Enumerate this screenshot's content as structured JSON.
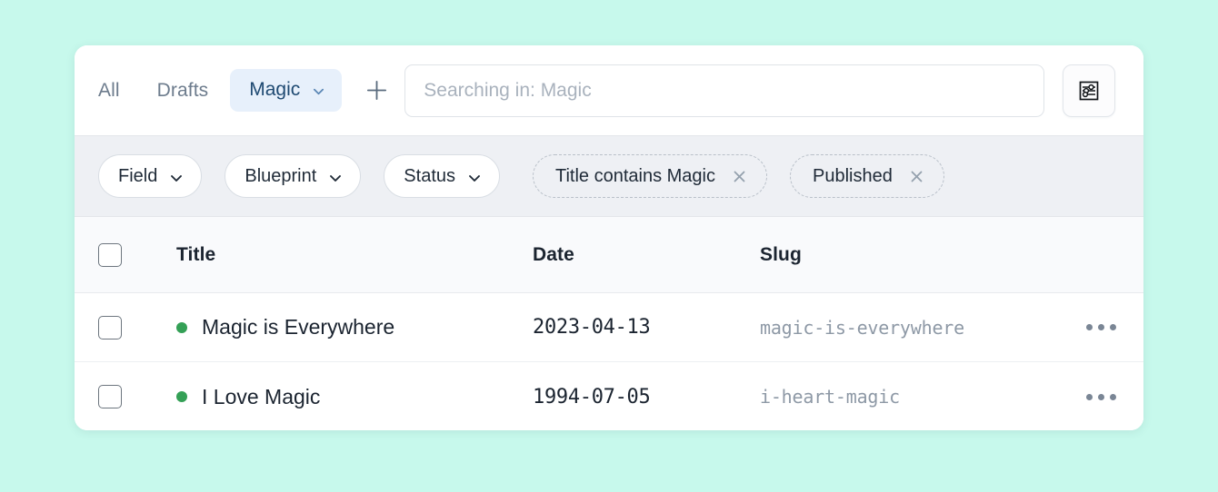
{
  "page": {
    "background_color": "#c7f9ec",
    "card_background": "#ffffff"
  },
  "topbar": {
    "tabs": [
      {
        "label": "All",
        "active": false
      },
      {
        "label": "Drafts",
        "active": false
      },
      {
        "label": "Magic",
        "active": true
      }
    ],
    "active_tab_chevron": "chevron-down-icon",
    "add_button": {
      "label": "+",
      "icon": "plus-icon"
    },
    "search": {
      "value": "",
      "placeholder": "Searching in: Magic",
      "icon": "search-input"
    },
    "filter_toggle": {
      "icon": "sliders-icon",
      "title": "Filters"
    },
    "colors": {
      "tab_inactive": "#6d7c8d",
      "tab_active_text": "#1f4a72",
      "tab_active_bg": "#e7f0fb"
    }
  },
  "filterbar": {
    "background_color": "#eef0f4",
    "dropdowns": [
      {
        "label": "Field",
        "icon": "chevron-down-icon"
      },
      {
        "label": "Blueprint",
        "icon": "chevron-down-icon"
      },
      {
        "label": "Status",
        "icon": "chevron-down-icon"
      }
    ],
    "chips": [
      {
        "label": "Title contains Magic",
        "remove_icon": "close-icon"
      },
      {
        "label": "Published",
        "remove_icon": "close-icon"
      }
    ]
  },
  "table": {
    "select_all": {
      "checked": false
    },
    "columns": [
      {
        "key": "title",
        "label": "Title"
      },
      {
        "key": "date",
        "label": "Date"
      },
      {
        "key": "slug",
        "label": "Slug"
      }
    ],
    "rows": [
      {
        "selected": false,
        "status": "published",
        "status_color": "#34a056",
        "title": "Magic is Everywhere",
        "date": "2023-04-13",
        "slug": "magic-is-everywhere",
        "actions_icon": "ellipsis-icon"
      },
      {
        "selected": false,
        "status": "published",
        "status_color": "#34a056",
        "title": "I Love Magic",
        "date": "1994-07-05",
        "slug": "i-heart-magic",
        "actions_icon": "ellipsis-icon"
      }
    ]
  }
}
